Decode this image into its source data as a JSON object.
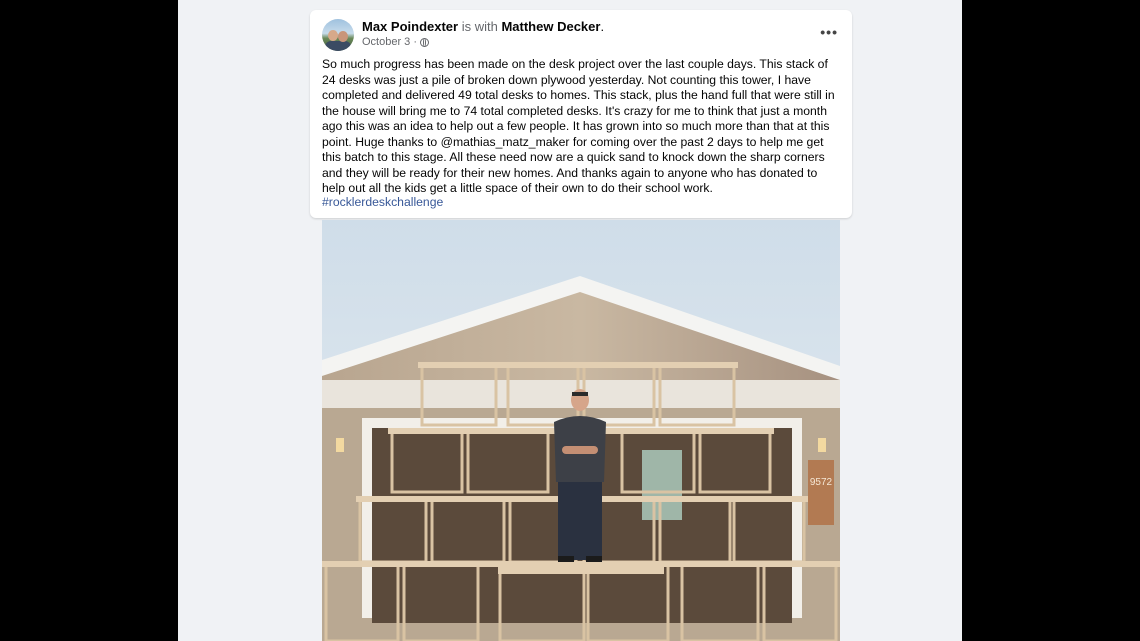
{
  "post": {
    "author": "Max Poindexter",
    "with_text": "is with",
    "tagged": "Matthew Decker",
    "period": ".",
    "date": "October 3",
    "separator": "·",
    "more_label": "•••",
    "body": "So much progress has been made on the desk project over the last couple days. This stack of 24 desks was just a pile of broken down plywood yesterday. Not counting this tower, I have completed and delivered 49 total desks to homes. This stack, plus the hand full that were still in the house will bring me to 74 total completed desks. It's crazy for me to think that just a month ago this was an idea to help out a few people. It has grown into so much more than that at this point. Huge thanks to @mathias_matz_maker for coming over the past 2 days to help me get this batch to this stage. All these need now are a quick sand to knock down the sharp corners and they will be ready for their new homes. And thanks again to anyone who has donated to help out all the kids get a little space of their own to do their school work.",
    "hashtag": "#rocklerdeskchallenge",
    "photo_house_number": "9572"
  },
  "icons": {
    "privacy": "globe-icon",
    "menu": "more-options-icon"
  },
  "colors": {
    "link": "#385898",
    "muted": "#65676b",
    "page_bg": "#f0f2f5"
  }
}
